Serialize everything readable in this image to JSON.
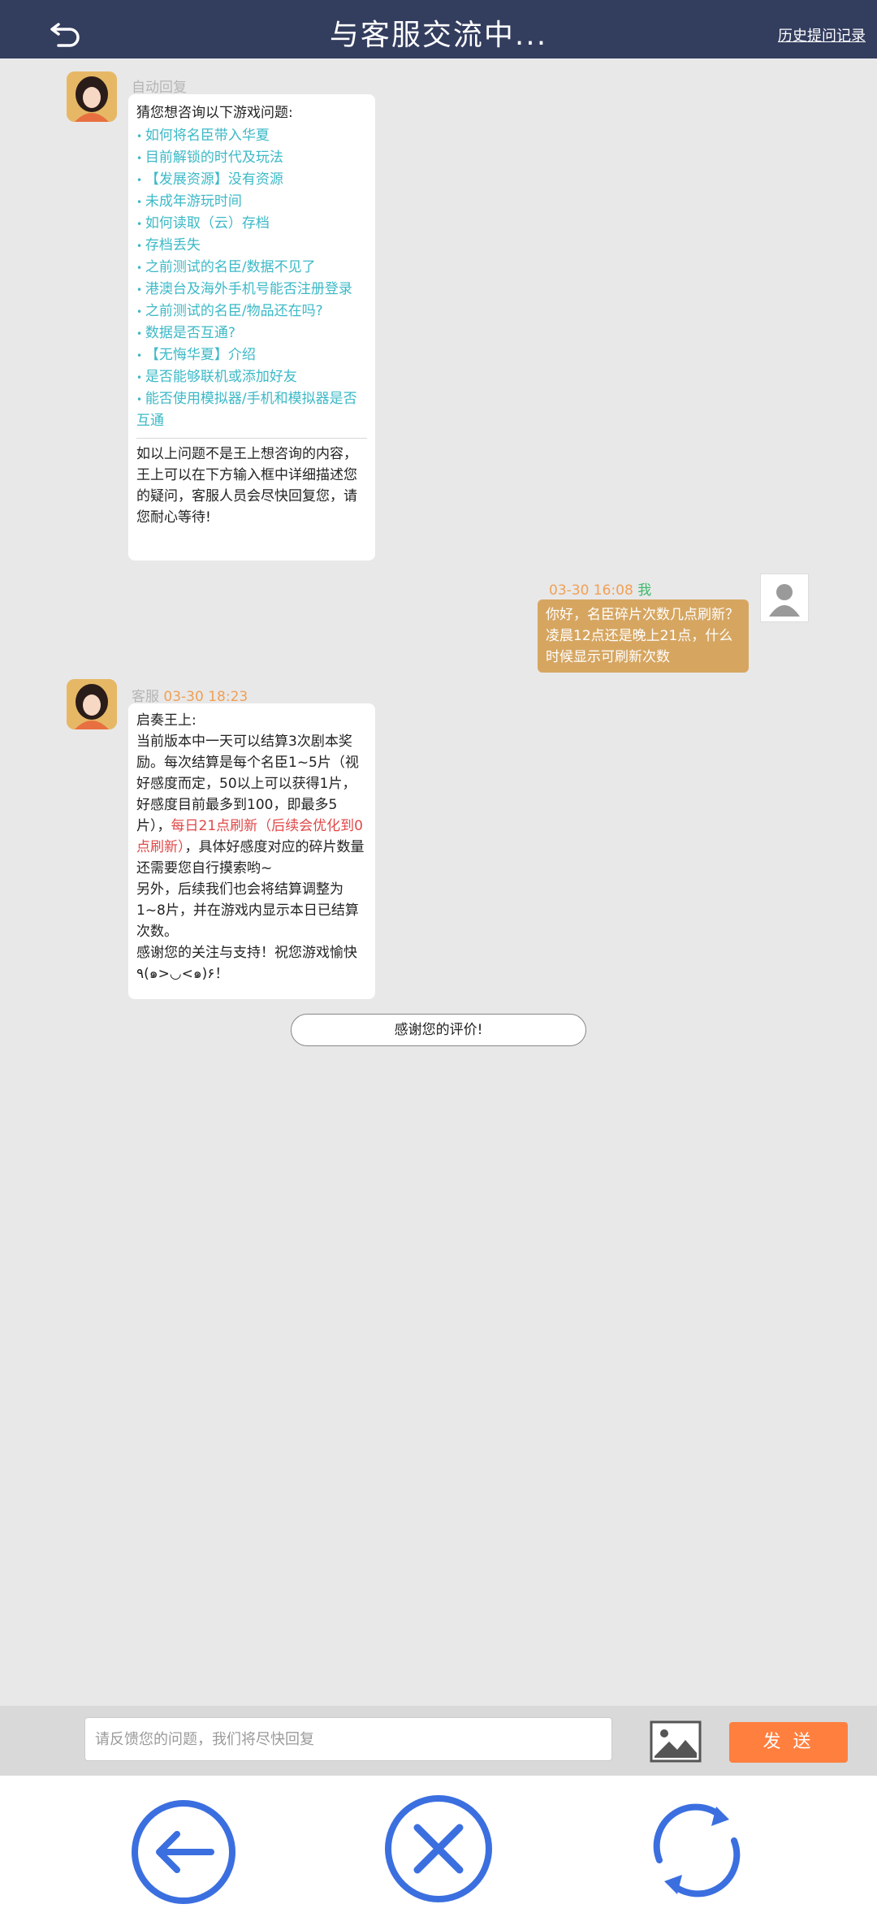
{
  "header": {
    "title": "与客服交流中...",
    "history_label": "历史提问记录",
    "back_icon": "back-arrow-icon"
  },
  "auto_reply": {
    "sender": "自动回复",
    "intro": "猜您想咨询以下游戏问题:",
    "items": [
      "如何将名臣带入华夏",
      "目前解锁的时代及玩法",
      "【发展资源】没有资源",
      "未成年游玩时间",
      "如何读取（云）存档",
      "存档丢失",
      "之前测试的名臣/数据不见了",
      "港澳台及海外手机号能否注册登录",
      "之前测试的名臣/物品还在吗?",
      "数据是否互通?",
      "【无悔华夏】介绍",
      "是否能够联机或添加好友",
      "能否使用模拟器/手机和模拟器是否互通"
    ],
    "footer": "如以上问题不是王上想咨询的内容，王上可以在下方输入框中详细描述您的疑问，客服人员会尽快回复您，请您耐心等待!"
  },
  "user_message": {
    "time": "03-30 16:08",
    "sender": "我",
    "text": "你好，名臣碎片次数几点刷新？凌晨12点还是晚上21点，什么时候显示可刷新次数"
  },
  "agent_reply": {
    "sender": "客服",
    "time": "03-30 18:23",
    "greeting": "启奏王上:",
    "part1": "当前版本中一天可以结算3次剧本奖励。每次结算是每个名臣1~5片（视好感度而定，50以上可以获得1片，好感度目前最多到100，即最多5片），",
    "highlight": "每日21点刷新（后续会优化到0点刷新）",
    "part2": "，具体好感度对应的碎片数量还需要您自行摸索哟~",
    "part3": "另外，后续我们也会将结算调整为1~8片，并在游戏内显示本日已结算次数。",
    "part4": "感谢您的关注与支持！祝您游戏愉快٩(๑>◡<๑)۶！"
  },
  "rating_label": "感谢您的评价!",
  "input": {
    "placeholder": "请反馈您的问题，我们将尽快回复",
    "image_icon": "image-icon",
    "send_label": "发 送"
  },
  "nav": {
    "back_icon": "circle-back-icon",
    "close_icon": "circle-close-icon",
    "refresh_icon": "refresh-icon",
    "accent": "#3b6fe0"
  }
}
